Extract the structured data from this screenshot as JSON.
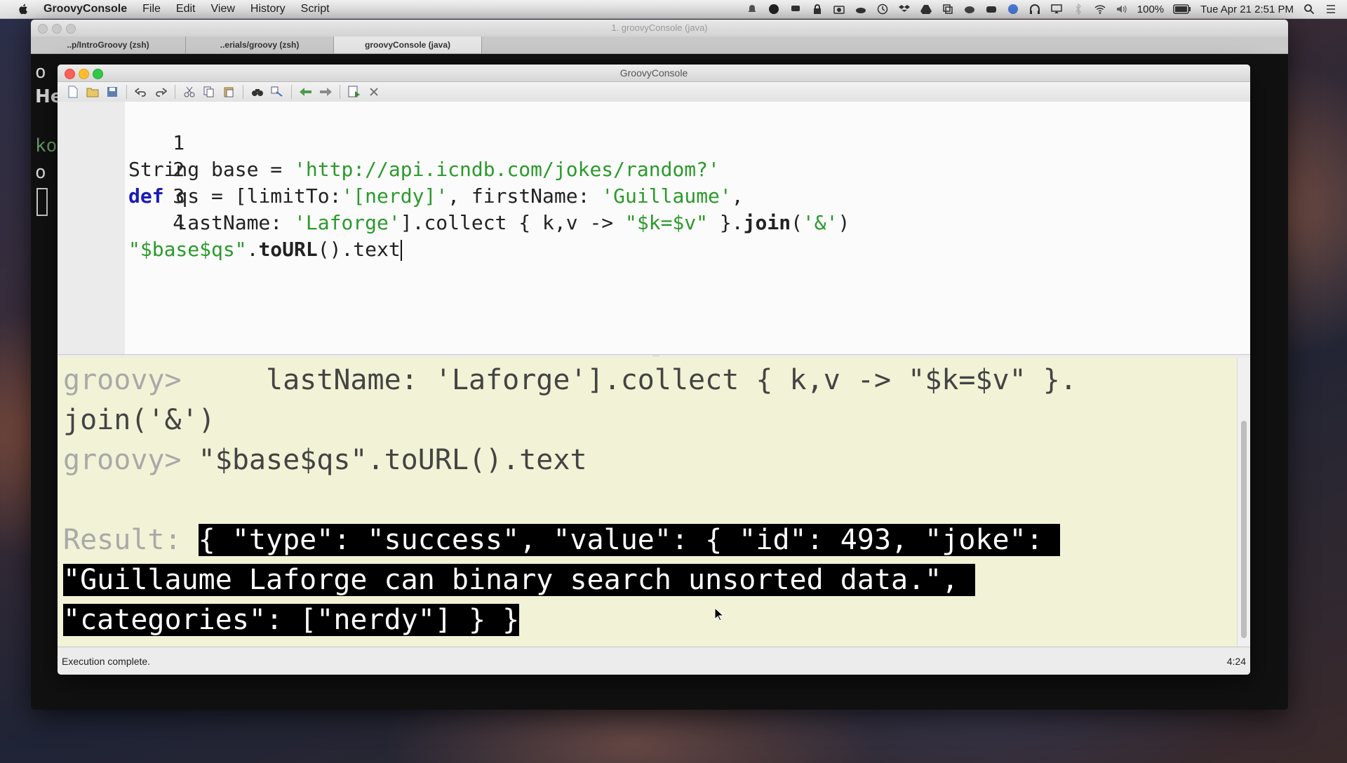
{
  "menubar": {
    "app_name": "GroovyConsole",
    "items": [
      "File",
      "Edit",
      "View",
      "History",
      "Script"
    ],
    "battery": "100%",
    "datetime": "Tue Apr 21  2:51 PM"
  },
  "terminal": {
    "title": "1. groovyConsole (java)",
    "tabs": [
      "..p/IntroGroovy (zsh)",
      "..erials/groovy (zsh)",
      "groovyConsole (java)"
    ],
    "active_tab": 2,
    "visible_text": {
      "line1": "o",
      "line2": "He",
      "line3": "ko",
      "line4": "o"
    }
  },
  "groovy_console": {
    "title": "GroovyConsole",
    "toolbar_icons": [
      "new-file-icon",
      "open-icon",
      "save-icon",
      "undo-icon",
      "redo-icon",
      "cut-icon",
      "copy-icon",
      "paste-icon",
      "find-icon",
      "replace-icon",
      "history-prev-icon",
      "history-next-icon",
      "run-icon",
      "interrupt-icon"
    ],
    "editor": {
      "line_numbers": [
        "1",
        "2",
        "3",
        "4"
      ],
      "lines": [
        {
          "text": "String base = ",
          "string": "'http://api.icndb.com/jokes/random?'"
        },
        {
          "keyword": "def",
          "text_a": " qs = [limitTo:",
          "str_a": "'[nerdy]'",
          "text_b": ", firstName: ",
          "str_b": "'Guillaume'",
          "text_c": ","
        },
        {
          "text_a": "    lastName: ",
          "str_a": "'Laforge'",
          "text_b": "].collect { k,v -> ",
          "str_b": "\"$k=$v\"",
          "text_c": " }.",
          "bold_a": "join",
          "text_d": "(",
          "str_c": "'&'",
          "text_e": ")"
        },
        {
          "str_a": "\"$base$qs\"",
          "text_a": ".",
          "bold_a": "toURL",
          "text_b": "().text"
        }
      ]
    },
    "output": {
      "prompt": "groovy>",
      "line1_code": "     lastName: 'Laforge'].collect { k,v -> \"$k=$v\" }.",
      "line2_code": "join('&')",
      "line3_code": " \"$base$qs\".toURL().text",
      "result_label": "Result: ",
      "result_line1": "{ \"type\": \"success\", \"value\": { \"id\": 493, \"joke\": ",
      "result_line2": "\"Guillaume Laforge can binary search unsorted data.\", ",
      "result_line3": "\"categories\": [\"nerdy\"] } }"
    },
    "status": {
      "message": "Execution complete.",
      "position": "4:24"
    }
  }
}
